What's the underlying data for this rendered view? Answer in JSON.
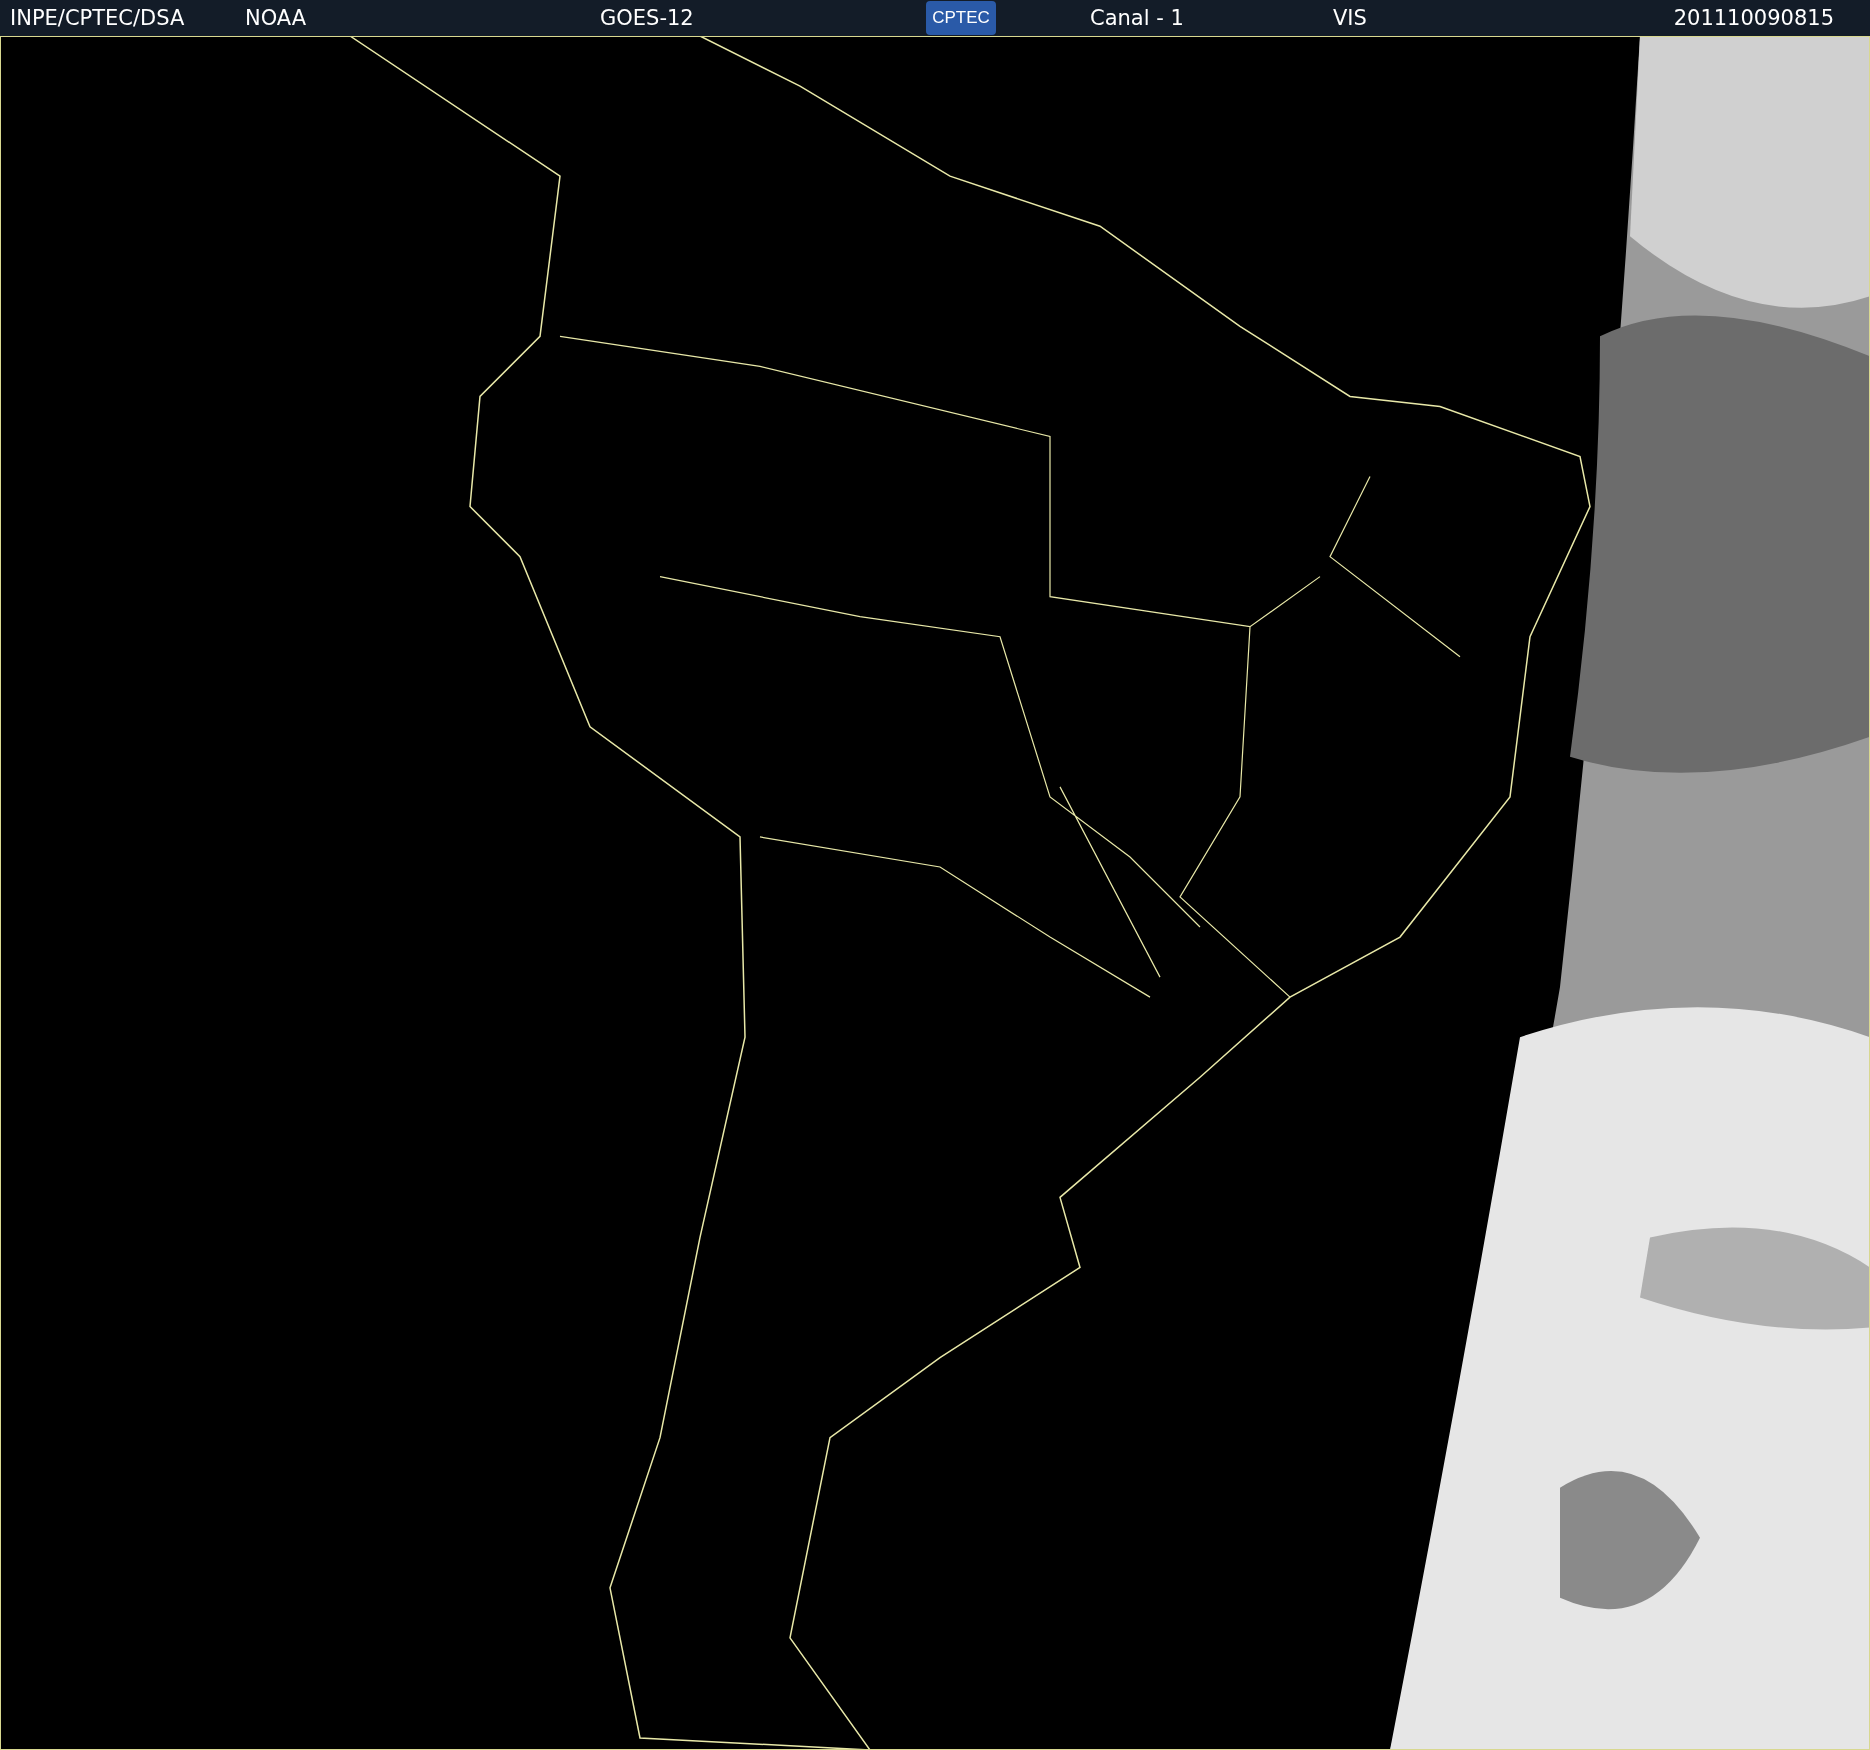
{
  "header": {
    "source": "INPE/CPTEC/DSA",
    "agency": "NOAA",
    "satellite": "GOES-12",
    "logo": "CPTEC",
    "channel": "Canal - 1",
    "band": "VIS",
    "timestamp": "201110090815"
  }
}
